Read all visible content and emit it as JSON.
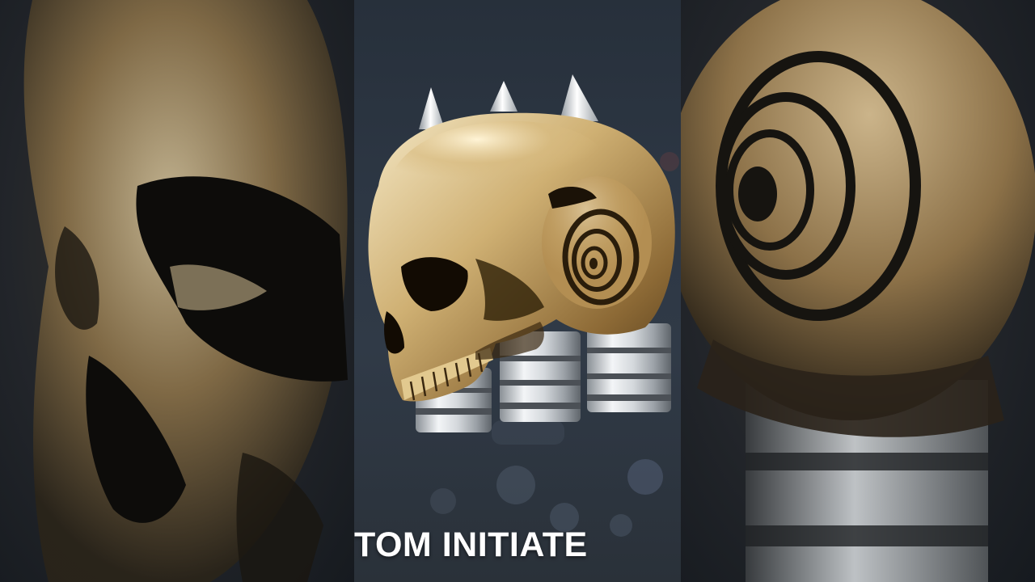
{
  "caption": {
    "text": "TOM INITIATE"
  },
  "colors": {
    "gold_light": "#efe0b8",
    "gold_mid": "#b8924f",
    "gold_dark": "#5a4220",
    "silver_light": "#f2f4f6",
    "silver_dark": "#6c7278",
    "panel_bg": "#2d3744"
  },
  "icons": {
    "emblem": "golden-skull-with-bullets-icon"
  }
}
